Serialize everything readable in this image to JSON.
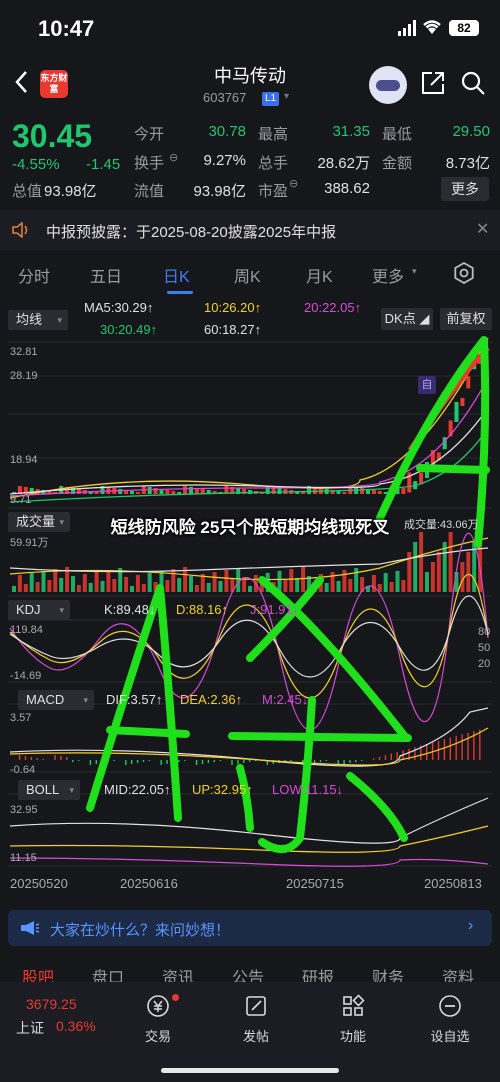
{
  "status": {
    "time": "10:47",
    "battery": "82"
  },
  "header": {
    "back_icon": "chevron-left-icon",
    "logo_text": "东方财富",
    "name": "中马传动",
    "code": "603767",
    "code_badge": "L1"
  },
  "quote": {
    "price": "30.45",
    "change_pct": "-4.55%",
    "change": "-1.45",
    "mcap_label": "总值",
    "mcap_value": "93.98亿",
    "cells": [
      {
        "label": "今开",
        "value": "30.78",
        "color": "#1fc76e"
      },
      {
        "label": "最高",
        "value": "31.35",
        "color": "#1fc76e"
      },
      {
        "label": "最低",
        "value": "29.50",
        "color": "#1fc76e"
      },
      {
        "label": "换手",
        "value": "9.27%",
        "color": "#e0e0e3"
      },
      {
        "label": "总手",
        "value": "28.62万",
        "color": "#e0e0e3"
      },
      {
        "label": "金额",
        "value": "8.73亿",
        "color": "#e0e0e3"
      },
      {
        "label": "流值",
        "value": "93.98亿",
        "color": "#e0e0e3"
      },
      {
        "label": "市盈",
        "value": "388.62",
        "color": "#e0e0e3"
      }
    ],
    "more": "更多"
  },
  "notice": {
    "text": "中报预披露：于2025-08-20披露2025年中报"
  },
  "tabs": {
    "items": [
      "分时",
      "五日",
      "日K",
      "周K",
      "月K",
      "更多"
    ],
    "active": 2
  },
  "chart": {
    "ma_selector": "均线",
    "ma5": "MA5:30.29↑",
    "ma10": "10:26.20↑",
    "ma20": "20:22.05↑",
    "ma30": "30:20.49↑",
    "ma60": "60:18.27↑",
    "dk_button": "DK点",
    "fq_button": "前复权",
    "price_ticks": [
      "32.81",
      "28.19",
      "18.94",
      "9.71"
    ],
    "vol_selector": "成交量",
    "vol_max": "59.91万",
    "vol_right": "成交量:43.06万",
    "kdj_selector": "KDJ",
    "kdj_k": "K:89.48↓",
    "kdj_d": "D:88.16↑",
    "kdj_j": "J:91.91↓",
    "kdj_top": "119.84",
    "kdj_bottom": "-14.69",
    "kdj_right": [
      "80",
      "50",
      "20"
    ],
    "macd_selector": "MACD",
    "macd_dif": "DIF:3.57↑",
    "macd_dea": "DEA:2.36↑",
    "macd_m": "M:2.45↓",
    "macd_top": "3.57",
    "macd_bottom": "-0.64",
    "boll_selector": "BOLL",
    "boll_mid": "MID:22.05↑",
    "boll_up": "UP:32.95↑",
    "boll_low": "LOW:11.15↓",
    "boll_top": "32.95",
    "boll_bottom": "11.15",
    "dates": [
      "20250520",
      "20250616",
      "20250715",
      "20250813"
    ],
    "badge_self": "自"
  },
  "overlay_title": "短线防风险 25只个股短期均线现死叉",
  "chat": {
    "text": "大家在炒什么？来问妙想！"
  },
  "subtabs": [
    "股吧",
    "盘口",
    "资讯",
    "公告",
    "研报",
    "财务",
    "资料"
  ],
  "bottom": {
    "index_value": "3679.25",
    "index_name": "上证",
    "index_pct": "0.36%",
    "nav": [
      "交易",
      "发帖",
      "功能",
      "设自选"
    ]
  },
  "colors": {
    "up": "#e8382f",
    "down": "#1fc76e",
    "accent": "#3c7df0",
    "background": "#16171b"
  }
}
